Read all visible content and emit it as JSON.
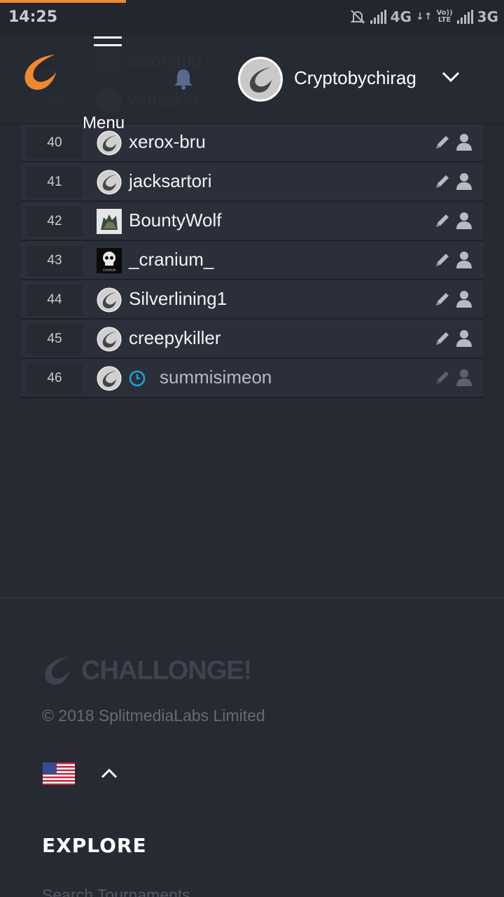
{
  "status_bar": {
    "time": "14:25",
    "network1": "4G",
    "volte_top": "Vo))",
    "volte_bottom": "LTE",
    "network2": "3G"
  },
  "header": {
    "menu_label": "Menu",
    "username": "Cryptobychirag"
  },
  "participants_behind_header": [
    {
      "seed": "38",
      "name": "asking00"
    },
    {
      "seed": "39",
      "name": "whizzkid"
    }
  ],
  "participants": [
    {
      "seed": "40",
      "name": "xerox-bru",
      "avatar": "challonge-avatar"
    },
    {
      "seed": "41",
      "name": "jacksartori",
      "avatar": "challonge-avatar"
    },
    {
      "seed": "42",
      "name": "BountyWolf",
      "avatar": "wolf-photo"
    },
    {
      "seed": "43",
      "name": "_cranium_",
      "avatar": "skull-photo",
      "avatar_caption": "CRANIUM"
    },
    {
      "seed": "44",
      "name": "Silverlining1",
      "avatar": "challonge-avatar"
    },
    {
      "seed": "45",
      "name": "creepykiller",
      "avatar": "challonge-avatar"
    },
    {
      "seed": "46",
      "name": "summisimeon",
      "avatar": "challonge-avatar",
      "pending": true
    }
  ],
  "footer": {
    "brand": "CHALLONGE!",
    "copyright": "© 2018 SplitmediaLabs Limited",
    "language_flag": "us-flag-icon",
    "explore_heading": "EXPLORE",
    "explore_links": [
      "Search Tournaments"
    ]
  },
  "colors": {
    "accent": "#f0882e",
    "background": "#262a33",
    "row": "#2b2f3a",
    "pending_clock": "#1fa2d6"
  }
}
